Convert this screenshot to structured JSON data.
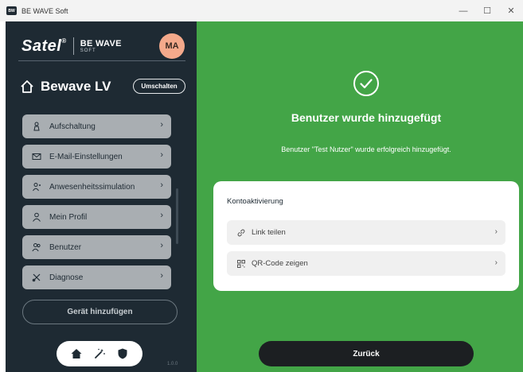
{
  "window": {
    "title": "BE WAVE Soft",
    "minimize": "—",
    "maximize": "☐",
    "close": "✕"
  },
  "sidebar": {
    "brand": "Satel",
    "brand_mark": "®",
    "product_line1": "BE WAVE",
    "product_line2": "SOFT",
    "avatar": "MA",
    "device_name": "Bewave LV",
    "switch_label": "Umschalten",
    "menu": [
      {
        "label": "Aufschaltung",
        "icon": "reception-icon"
      },
      {
        "label": "E-Mail-Einstellungen",
        "icon": "mail-icon"
      },
      {
        "label": "Anwesenheitssimulation",
        "icon": "simulation-icon"
      },
      {
        "label": "Mein Profil",
        "icon": "user-icon"
      },
      {
        "label": "Benutzer",
        "icon": "users-icon"
      },
      {
        "label": "Diagnose",
        "icon": "tools-icon"
      }
    ],
    "chevron": "›",
    "add_device": "Gerät hinzufügen",
    "version": "1.0.0"
  },
  "main": {
    "title": "Benutzer wurde hinzugefügt",
    "message": "Benutzer \"Test Nutzer\" wurde erfolgreich hinzugefügt.",
    "card": {
      "title": "Kontoaktivierung",
      "rows": [
        {
          "label": "Link teilen",
          "icon": "link-icon"
        },
        {
          "label": "QR-Code zeigen",
          "icon": "qr-code-icon"
        }
      ]
    },
    "back_button": "Zurück"
  },
  "colors": {
    "sidebar_bg": "#1e2a33",
    "main_bg": "#43a547",
    "menu_item_bg": "#a9aeb2",
    "avatar_bg": "#f4a98b",
    "back_button_bg": "#1c1f22"
  }
}
